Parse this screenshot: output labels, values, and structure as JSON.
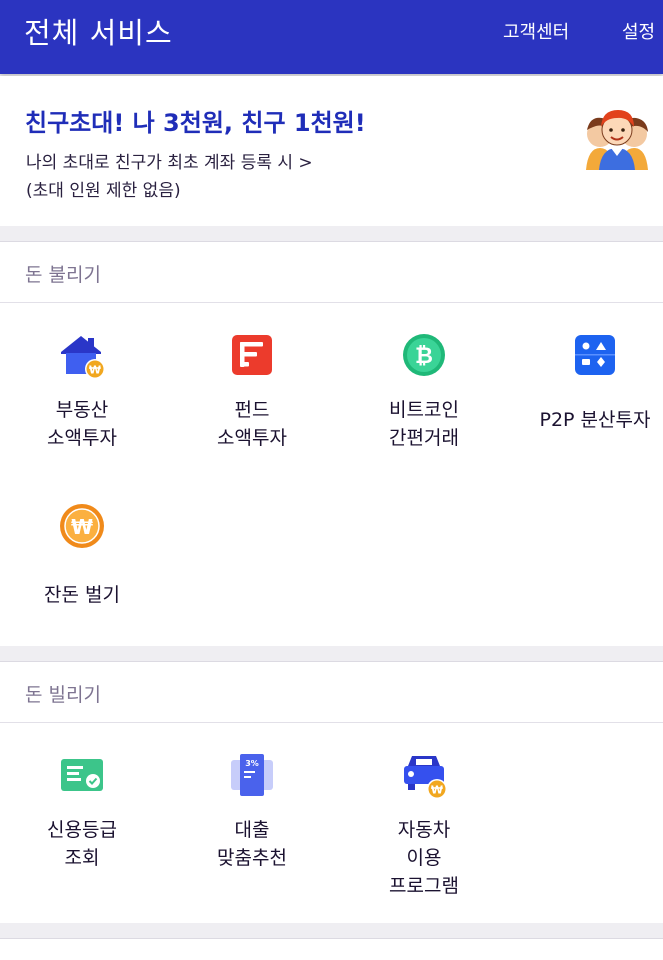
{
  "header": {
    "title": "전체 서비스",
    "customer_center": "고객센터",
    "settings": "설정"
  },
  "promo": {
    "headline": "친구초대! 나 3천원, 친구 1천원!",
    "line1": "나의 초대로 친구가 최초 계좌 등록 시 >",
    "line2": "(초대 인원 제한 없음)",
    "illustration": "friends-illustration"
  },
  "sections": {
    "grow": {
      "title": "돈 불리기",
      "items": [
        {
          "lines": [
            "부동산",
            "소액투자"
          ],
          "icon": "house-won-icon"
        },
        {
          "lines": [
            "펀드",
            "소액투자"
          ],
          "icon": "fund-icon"
        },
        {
          "lines": [
            "비트코인",
            "간편거래"
          ],
          "icon": "bitcoin-icon"
        },
        {
          "lines": [
            "P2P 분산투자"
          ],
          "icon": "p2p-icon"
        },
        {
          "lines": [
            "잔돈 벌기"
          ],
          "icon": "won-coin-icon"
        }
      ]
    },
    "borrow": {
      "title": "돈 빌리기",
      "items": [
        {
          "lines": [
            "신용등급",
            "조회"
          ],
          "icon": "credit-card-check-icon"
        },
        {
          "lines": [
            "대출",
            "맞춤추천"
          ],
          "icon": "loan-rate-icon",
          "badge": "3%"
        },
        {
          "lines": [
            "자동차",
            "이용",
            "프로그램"
          ],
          "icon": "car-won-icon"
        }
      ]
    }
  },
  "colors": {
    "header": "#2b34c0",
    "headline": "#1f2db8",
    "section_title": "#7e7491"
  }
}
